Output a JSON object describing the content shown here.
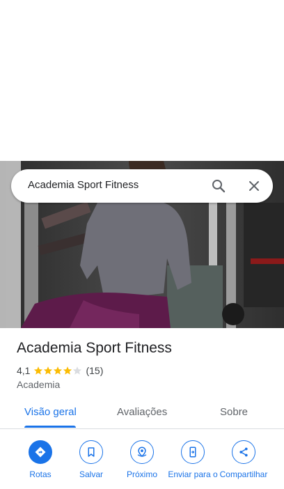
{
  "search": {
    "query": "Academia Sport Fitness"
  },
  "place": {
    "title": "Academia Sport Fitness",
    "rating": "4,1",
    "rating_value": 4.1,
    "reviews": "(15)",
    "category": "Academia"
  },
  "tabs": [
    {
      "label": "Visão geral",
      "active": true
    },
    {
      "label": "Avaliações",
      "active": false
    },
    {
      "label": "Sobre",
      "active": false
    }
  ],
  "actions": [
    {
      "label": "Rotas",
      "icon": "directions-icon"
    },
    {
      "label": "Salvar",
      "icon": "bookmark-icon"
    },
    {
      "label": "Próximo",
      "icon": "nearby-icon"
    },
    {
      "label": "Enviar para o",
      "icon": "send-to-phone-icon"
    },
    {
      "label": "Compartilhar",
      "icon": "share-icon"
    }
  ],
  "colors": {
    "accent": "#1a73e8",
    "star": "#fbbc04"
  }
}
